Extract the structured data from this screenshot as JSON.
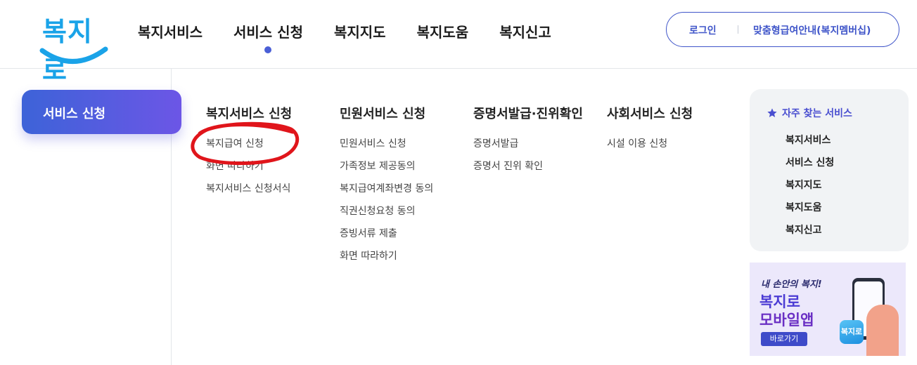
{
  "header": {
    "logo_text": "복지로",
    "nav": [
      {
        "label": "복지서비스",
        "active": false
      },
      {
        "label": "서비스 신청",
        "active": true
      },
      {
        "label": "복지지도",
        "active": false
      },
      {
        "label": "복지도움",
        "active": false
      },
      {
        "label": "복지신고",
        "active": false
      }
    ],
    "login_label": "로그인",
    "member_label": "맞춤형급여안내(복지멤버십)"
  },
  "sidebar": {
    "current_label": "서비스 신청"
  },
  "menu": {
    "columns": [
      {
        "title": "복지서비스 신청",
        "items": [
          "복지급여 신청",
          "화면 따라하기",
          "복지서비스 신청서식"
        ]
      },
      {
        "title": "민원서비스 신청",
        "items": [
          "민원서비스 신청",
          "가족정보 제공동의",
          "복지급여계좌변경 동의",
          "직권신청요청 동의",
          "증빙서류 제출",
          "화면 따라하기"
        ]
      },
      {
        "title": "증명서발급·진위확인",
        "items": [
          "증명서발급",
          "증명서 진위 확인"
        ]
      },
      {
        "title": "사회서비스 신청",
        "items": [
          "시설 이용 신청"
        ]
      }
    ]
  },
  "favorites": {
    "title": "자주 찾는 서비스",
    "items": [
      "복지서비스",
      "서비스 신청",
      "복지지도",
      "복지도움",
      "복지신고"
    ]
  },
  "banner": {
    "tagline": "내 손안의 복지!",
    "line1": "복지로",
    "line2": "모바일앱",
    "button": "바로가기",
    "app_icon_text": "복지로"
  },
  "colors": {
    "accent": "#3f55c9",
    "logo": "#1aa3e8",
    "annotation": "#e0151b"
  }
}
